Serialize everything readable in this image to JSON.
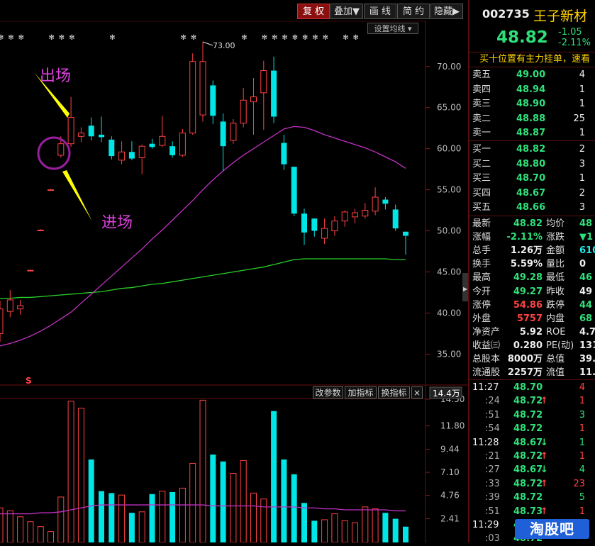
{
  "toolbar": {
    "buttons": [
      "复 权",
      "叠加▼",
      "画 线",
      "简 约",
      "隐藏▶"
    ],
    "ma_setting": "设置均线"
  },
  "price_axis": [
    "70.00",
    "65.00",
    "60.00",
    "55.00",
    "50.00",
    "45.00",
    "40.00",
    "35.00"
  ],
  "high_marker": "73.00",
  "annotations": {
    "exit": "出场",
    "entry": "进场"
  },
  "s_marker": "S",
  "indicator_buttons": [
    "改参数",
    "加指标",
    "换指标",
    "×"
  ],
  "volume_unit": "14.4万",
  "volume_axis": [
    "14.50",
    "11.80",
    "9.44",
    "7.10",
    "4.76",
    "2.41"
  ],
  "colors": {
    "up": "#ff4242",
    "down": "#00e5e5",
    "ma_slow": "#c431c4",
    "ma_long": "#28d028",
    "annotation": "#e040e0",
    "arrow": "#ffff00",
    "price_down": "#2fe07a"
  },
  "chart_data": [
    {
      "type": "candlestick",
      "title": "",
      "ylim": [
        31.5,
        75.5
      ],
      "candles": [
        {
          "open": 37.5,
          "close": 40.5,
          "high": 41.5,
          "low": 36.5
        },
        {
          "open": 40.2,
          "close": 41.6,
          "high": 42.8,
          "low": 39.5
        },
        {
          "open": 40.5,
          "close": 40.9,
          "high": 41.6,
          "low": 39.8
        },
        {
          "open": 45.2,
          "close": 45.2,
          "high": 45.3,
          "low": 45.1
        },
        {
          "open": 50.1,
          "close": 50.1,
          "high": 50.2,
          "low": 50.0
        },
        {
          "open": 55.0,
          "close": 55.0,
          "high": 55.1,
          "low": 54.9
        },
        {
          "open": 59.2,
          "close": 60.6,
          "high": 61.5,
          "low": 58.9
        },
        {
          "open": 60.6,
          "close": 63.8,
          "high": 66.3,
          "low": 60.2
        },
        {
          "open": 61.5,
          "close": 61.9,
          "high": 62.6,
          "low": 60.8
        },
        {
          "open": 62.8,
          "close": 61.5,
          "high": 63.8,
          "low": 61.0
        },
        {
          "open": 61.7,
          "close": 61.4,
          "high": 63.9,
          "low": 60.8
        },
        {
          "open": 61.1,
          "close": 59.1,
          "high": 61.5,
          "low": 58.7
        },
        {
          "open": 58.6,
          "close": 59.6,
          "high": 60.9,
          "low": 58.1
        },
        {
          "open": 59.6,
          "close": 58.8,
          "high": 60.9,
          "low": 58.6
        },
        {
          "open": 58.9,
          "close": 60.3,
          "high": 60.5,
          "low": 56.9
        },
        {
          "open": 60.6,
          "close": 60.2,
          "high": 61.2,
          "low": 60.0
        },
        {
          "open": 60.4,
          "close": 61.5,
          "high": 64.0,
          "low": 60.2
        },
        {
          "open": 60.3,
          "close": 59.2,
          "high": 60.9,
          "low": 58.9
        },
        {
          "open": 59.2,
          "close": 61.9,
          "high": 62.4,
          "low": 59.0
        },
        {
          "open": 61.9,
          "close": 70.6,
          "high": 71.6,
          "low": 61.7
        },
        {
          "open": 64.1,
          "close": 70.6,
          "high": 73.0,
          "low": 63.3
        },
        {
          "open": 67.7,
          "close": 64.0,
          "high": 68.3,
          "low": 63.0
        },
        {
          "open": 63.3,
          "close": 60.3,
          "high": 64.3,
          "low": 57.3
        },
        {
          "open": 61.0,
          "close": 63.1,
          "high": 63.6,
          "low": 60.6
        },
        {
          "open": 63.1,
          "close": 65.9,
          "high": 67.4,
          "low": 62.6
        },
        {
          "open": 65.7,
          "close": 66.3,
          "high": 68.6,
          "low": 61.7
        },
        {
          "open": 66.8,
          "close": 69.5,
          "high": 70.7,
          "low": 62.3
        },
        {
          "open": 69.5,
          "close": 63.9,
          "high": 71.2,
          "low": 63.1
        },
        {
          "open": 60.7,
          "close": 58.1,
          "high": 61.7,
          "low": 57.4
        },
        {
          "open": 57.8,
          "close": 52.1,
          "high": 57.8,
          "low": 51.8
        },
        {
          "open": 52.1,
          "close": 49.8,
          "high": 52.7,
          "low": 48.3
        },
        {
          "open": 51.5,
          "close": 50.0,
          "high": 51.5,
          "low": 49.3
        },
        {
          "open": 49.1,
          "close": 50.3,
          "high": 51.5,
          "low": 48.4
        },
        {
          "open": 50.0,
          "close": 51.2,
          "high": 51.8,
          "low": 49.4
        },
        {
          "open": 51.2,
          "close": 52.3,
          "high": 52.5,
          "low": 50.5
        },
        {
          "open": 51.7,
          "close": 52.2,
          "high": 52.7,
          "low": 50.9
        },
        {
          "open": 51.8,
          "close": 52.5,
          "high": 53.4,
          "low": 51.5
        },
        {
          "open": 52.4,
          "close": 54.1,
          "high": 55.3,
          "low": 51.9
        },
        {
          "open": 53.8,
          "close": 53.3,
          "high": 54.1,
          "low": 52.6
        },
        {
          "open": 52.6,
          "close": 50.3,
          "high": 53.2,
          "low": 50.0
        },
        {
          "open": 49.9,
          "close": 49.4,
          "high": 49.9,
          "low": 47.1
        }
      ],
      "ma_slow": [
        36.0,
        36.3,
        36.7,
        37.2,
        37.8,
        38.5,
        39.3,
        40.1,
        41.2,
        42.3,
        43.4,
        44.5,
        45.6,
        46.7,
        47.8,
        49.0,
        50.1,
        51.3,
        52.5,
        53.7,
        55.0,
        56.2,
        57.3,
        58.3,
        59.2,
        60.0,
        60.8,
        61.6,
        62.4,
        62.7,
        62.6,
        62.2,
        61.7,
        61.3,
        60.9,
        60.5,
        60.1,
        59.6,
        59.0,
        58.4,
        57.6
      ],
      "ma_long": [
        41.8,
        41.8,
        41.9,
        41.9,
        42.0,
        42.1,
        42.2,
        42.3,
        42.4,
        42.5,
        42.6,
        42.8,
        43.0,
        43.1,
        43.3,
        43.5,
        43.6,
        43.8,
        44.0,
        44.2,
        44.4,
        44.6,
        44.8,
        45.0,
        45.2,
        45.4,
        45.6,
        45.9,
        46.2,
        46.5,
        46.6,
        46.6,
        46.6,
        46.6,
        46.6,
        46.6,
        46.6,
        46.6,
        46.6,
        46.5,
        46.5
      ],
      "flags": [
        "✻",
        "✻",
        "✻",
        "",
        "",
        "✻",
        "✻",
        "✻",
        "",
        "",
        "",
        "✻",
        "",
        "",
        "",
        "",
        "",
        "",
        "✻",
        "✻",
        "",
        "",
        "",
        "",
        "✻",
        "",
        "✻",
        "✻",
        "✻",
        "✻",
        "✻",
        "✻",
        "✻",
        "",
        "✻",
        "✻",
        "",
        "",
        "",
        "",
        ""
      ]
    },
    {
      "type": "bar",
      "title": "",
      "ylim": [
        0,
        14.5
      ],
      "values": [
        3.5,
        3.2,
        2.6,
        2.1,
        1.6,
        1.1,
        4.6,
        14.3,
        13.6,
        8.4,
        5.2,
        5.0,
        4.8,
        3.0,
        3.1,
        4.9,
        5.2,
        5.1,
        5.5,
        8.0,
        14.4,
        8.9,
        8.2,
        7.0,
        8.3,
        5.0,
        4.4,
        13.3,
        8.4,
        6.9,
        4.0,
        2.2,
        2.3,
        2.9,
        2.2,
        2.0,
        3.6,
        3.4,
        3.0,
        2.4,
        1.6
      ],
      "volume_ma": [
        2.9,
        2.9,
        2.9,
        2.9,
        3.0,
        3.0,
        3.1,
        3.3,
        3.5,
        3.7,
        3.8,
        3.8,
        3.8,
        3.8,
        3.8,
        3.8,
        3.8,
        3.8,
        3.8,
        3.8,
        3.8,
        3.7,
        3.7,
        3.7,
        3.7,
        3.7,
        3.6,
        3.6,
        3.6,
        3.6,
        3.5,
        3.5,
        3.4,
        3.4,
        3.3,
        3.3,
        3.3,
        3.3,
        3.3,
        3.2,
        3.2
      ],
      "axis_ticks": [
        "14.50",
        "11.80",
        "9.44",
        "7.10",
        "4.76",
        "2.41"
      ]
    }
  ],
  "quote": {
    "code": "002735",
    "name": "王子新材",
    "price": "48.82",
    "change": "-1.05",
    "change_pct": "-2.11%",
    "notice": "买十位置有主力挂单，速看"
  },
  "order_book": {
    "asks": [
      {
        "label": "卖五",
        "price": "49.00",
        "vol": "4"
      },
      {
        "label": "卖四",
        "price": "48.94",
        "vol": "1"
      },
      {
        "label": "卖三",
        "price": "48.90",
        "vol": "1"
      },
      {
        "label": "卖二",
        "price": "48.88",
        "vol": "25"
      },
      {
        "label": "卖一",
        "price": "48.87",
        "vol": "1"
      }
    ],
    "bids": [
      {
        "label": "买一",
        "price": "48.82",
        "vol": "2"
      },
      {
        "label": "买二",
        "price": "48.80",
        "vol": "3"
      },
      {
        "label": "买三",
        "price": "48.70",
        "vol": "1"
      },
      {
        "label": "买四",
        "price": "48.67",
        "vol": "2"
      },
      {
        "label": "买五",
        "price": "48.66",
        "vol": "3"
      }
    ]
  },
  "stats": [
    {
      "l1": "最新",
      "v1": "48.82",
      "c1": "green",
      "l2": "均价",
      "v2": "48",
      "c2": "green"
    },
    {
      "l1": "涨幅",
      "v1": "-2.11%",
      "c1": "green",
      "l2": "涨跌",
      "v2": "▼1",
      "c2": "green"
    },
    {
      "l1": "总手",
      "v1": "1.26万",
      "c1": "white",
      "l2": "金额",
      "v2": "610",
      "c2": "cyan"
    },
    {
      "l1": "换手",
      "v1": "5.59%",
      "c1": "white",
      "l2": "量比",
      "v2": "0",
      "c2": "white"
    },
    {
      "l1": "最高",
      "v1": "49.28",
      "c1": "green",
      "l2": "最低",
      "v2": "46",
      "c2": "green"
    },
    {
      "l1": "今开",
      "v1": "49.27",
      "c1": "green",
      "l2": "昨收",
      "v2": "49",
      "c2": "white"
    },
    {
      "l1": "涨停",
      "v1": "54.86",
      "c1": "red",
      "l2": "跌停",
      "v2": "44",
      "c2": "green"
    },
    {
      "l1": "外盘",
      "v1": "5757",
      "c1": "red",
      "l2": "内盘",
      "v2": "68",
      "c2": "green"
    },
    {
      "l1": "净资产",
      "v1": "5.92",
      "c1": "white",
      "l2": "ROE",
      "v2": "4.7",
      "c2": "white"
    },
    {
      "l1": "收益㈢",
      "v1": "0.280",
      "c1": "white",
      "l2": "PE(动)",
      "v2": "131",
      "c2": "white"
    },
    {
      "l1": "总股本",
      "v1": "8000万",
      "c1": "white",
      "l2": "总值",
      "v2": "39.1",
      "c2": "white"
    },
    {
      "l1": "流通股",
      "v1": "2257万",
      "c1": "white",
      "l2": "流值",
      "v2": "11.0",
      "c2": "white"
    }
  ],
  "ticks": [
    {
      "time": "11:27",
      "price": "48.70",
      "arrow": "",
      "vol": "4",
      "vc": "red",
      "tc": "white"
    },
    {
      "time": ":24",
      "price": "48.72",
      "arrow": "↑",
      "vol": "1",
      "vc": "red",
      "tc": "gray"
    },
    {
      "time": ":51",
      "price": "48.72",
      "arrow": "",
      "vol": "3",
      "vc": "green",
      "tc": "gray"
    },
    {
      "time": ":54",
      "price": "48.72",
      "arrow": "",
      "vol": "1",
      "vc": "red",
      "tc": "gray"
    },
    {
      "time": "11:28",
      "price": "48.67",
      "arrow": "↓",
      "vol": "1",
      "vc": "green",
      "tc": "white"
    },
    {
      "time": ":21",
      "price": "48.72",
      "arrow": "↑",
      "vol": "1",
      "vc": "red",
      "tc": "gray"
    },
    {
      "time": ":27",
      "price": "48.67",
      "arrow": "↓",
      "vol": "4",
      "vc": "green",
      "tc": "gray"
    },
    {
      "time": ":33",
      "price": "48.72",
      "arrow": "↑",
      "vol": "23",
      "vc": "red",
      "tc": "gray"
    },
    {
      "time": ":39",
      "price": "48.72",
      "arrow": "",
      "vol": "5",
      "vc": "green",
      "tc": "gray"
    },
    {
      "time": ":51",
      "price": "48.73",
      "arrow": "↑",
      "vol": "1",
      "vc": "red",
      "tc": "gray"
    },
    {
      "time": "11:29",
      "price": "48.73",
      "arrow": "",
      "vol": "",
      "vc": "red",
      "tc": "white"
    },
    {
      "time": ":03",
      "price": "48.72",
      "arrow": "",
      "vol": "",
      "vc": "red",
      "tc": "gray"
    }
  ],
  "watermark": "淘股吧"
}
